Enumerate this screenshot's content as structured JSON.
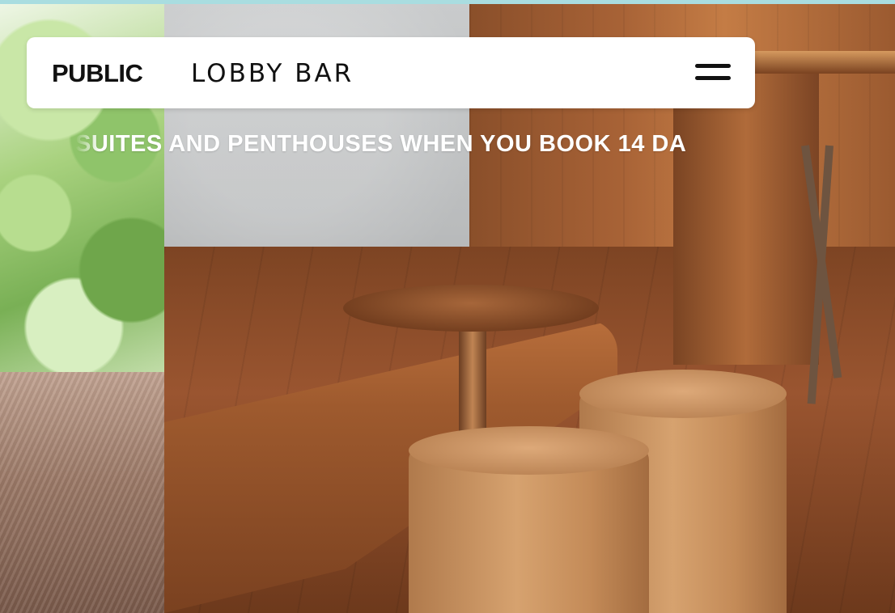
{
  "header": {
    "logo": "PUBLIC",
    "title": "LOBBY BAR",
    "menu_icon": "hamburger-menu-icon"
  },
  "promo": {
    "text": "SUITES AND PENTHOUSES WHEN YOU BOOK 14 DA"
  },
  "colors": {
    "header_bg": "#ffffff",
    "text_dark": "#111111",
    "top_strip": "#a9dde0",
    "promo_text": "#ffffff"
  }
}
